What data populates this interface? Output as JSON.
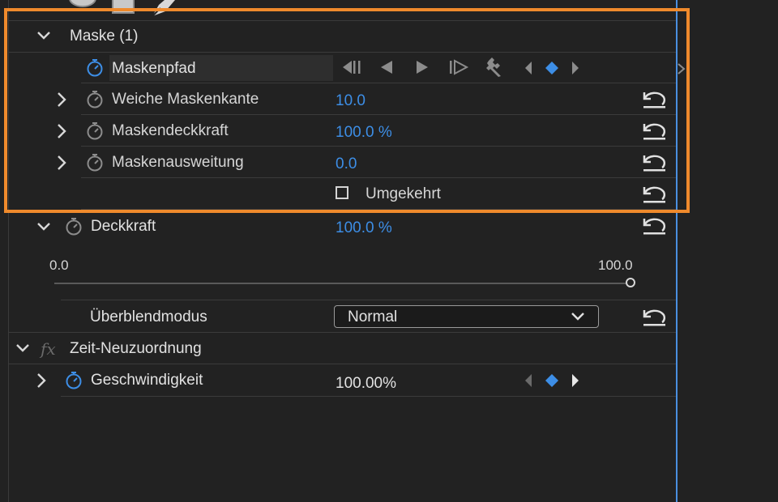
{
  "colors": {
    "background": "#222222",
    "highlight_border": "#ef8a2c",
    "value_blue": "#3d8ee6",
    "playhead_blue": "#4a8fe0"
  },
  "mask_group": {
    "title": "Maske (1)",
    "mask_path": {
      "label": "Maskenpfad"
    },
    "properties": [
      {
        "label": "Weiche Maskenkante",
        "value": "10.0"
      },
      {
        "label": "Maskendeckkraft",
        "value": "100.0 %"
      },
      {
        "label": "Maskenausweitung",
        "value": "0.0"
      }
    ],
    "inverted": {
      "label": "Umgekehrt",
      "checked": false
    }
  },
  "opacity": {
    "label": "Deckkraft",
    "value": "100.0 %",
    "slider_min": "0.0",
    "slider_max": "100.0",
    "slider_level": 1.0
  },
  "blend_mode": {
    "label": "Überblendmodus",
    "selected": "Normal"
  },
  "time_remap": {
    "section_label": "Zeit-Neuzuordnung",
    "fx_glyph": "fx",
    "speed": {
      "label": "Geschwindigkeit",
      "value": "100.00%"
    }
  },
  "icons": [
    "chevron-down-icon",
    "chevron-right-icon",
    "stopwatch-icon",
    "reset-icon",
    "keyframe-diamond-icon",
    "go-to-previous-keyframe-icon",
    "play-backward-icon",
    "play-forward-icon",
    "go-to-next-keyframe-icon",
    "wrench-icon",
    "ellipse-mask-icon",
    "rectangle-mask-icon",
    "pen-tool-icon",
    "fx-icon"
  ]
}
